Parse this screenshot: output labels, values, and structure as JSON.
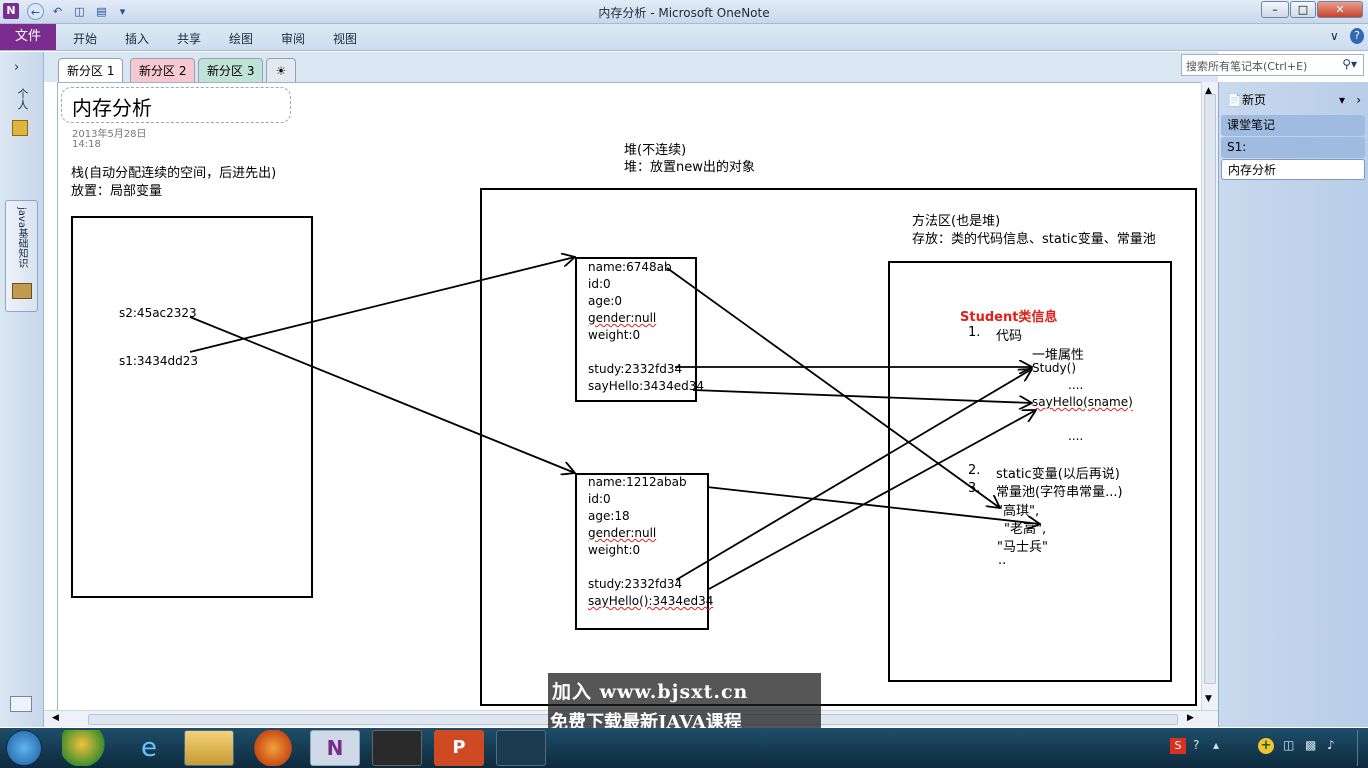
{
  "window": {
    "title": "内存分析 - Microsoft OneNote",
    "app_icon": "N"
  },
  "ribbon": {
    "file_label": "文件",
    "tabs": [
      "开始",
      "插入",
      "共享",
      "绘图",
      "审阅",
      "视图"
    ]
  },
  "section_tabs": [
    "新分区 1",
    "新分区 2",
    "新分区 3"
  ],
  "search": {
    "placeholder": "搜索所有笔记本(Ctrl+E)"
  },
  "leftnav": {
    "notebook_label": "java基础知识",
    "personal_label": "个人"
  },
  "pagelist": {
    "new_page": "新页",
    "items": [
      "课堂笔记",
      "S1:",
      "内存分析"
    ]
  },
  "page": {
    "title": "内存分析",
    "date": "2013年5月28日",
    "time": "14:18",
    "stack_heading": "栈(自动分配连续的空间，后进先出)",
    "stack_store": "放置：局部变量",
    "stack_vars": [
      "s2:45ac2323",
      "s1:3434dd23"
    ],
    "heap_heading": "堆(不连续)",
    "heap_store": "堆：放置new出的对象",
    "obj1": [
      "name:6748ab",
      "id:0",
      "age:0",
      "gender:null",
      "weight:0",
      "",
      "study:2332fd34",
      "sayHello:3434ed34"
    ],
    "obj2": [
      "name:1212abab",
      "id:0",
      "age:18",
      "gender:null",
      "weight:0",
      "",
      "study:2332fd34",
      "sayHello():3434ed34"
    ],
    "method_heading": "方法区(也是堆)",
    "method_store": "存放：类的代码信息、static变量、常量池",
    "class_title": "Student类信息",
    "item1_num": "1.",
    "item1": "代码",
    "props": "一堆属性",
    "study": "Study()",
    "dots1": "....",
    "sayhello": "sayHello(sname)",
    "dots2": "....",
    "item2_num": "2.",
    "item2": "static变量(以后再说)",
    "item3_num": "3.",
    "item3": "常量池(字符串常量...)",
    "const1": "\"高琪\",",
    "const2": "\"老高\",",
    "const3": "\"马士兵\"",
    "const4": ".."
  },
  "watermark": {
    "line1": "加入 www.bjsxt.cn",
    "line2": "免费下载最新JAVA课程"
  }
}
